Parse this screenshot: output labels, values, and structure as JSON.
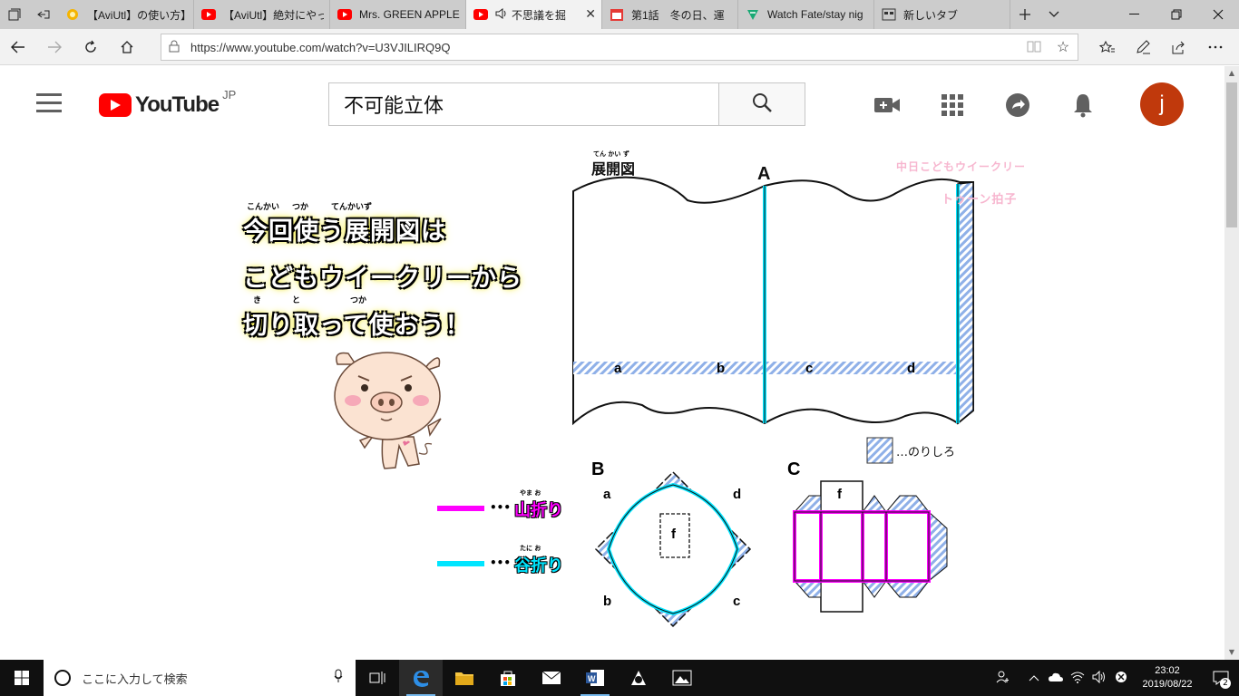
{
  "tabs": [
    {
      "title": "【AviUtl】の使い方】導",
      "icon": "sun-favicon-icon",
      "active": false
    },
    {
      "title": "【AviUtl】絶対にやって",
      "icon": "youtube-favicon-icon",
      "active": false
    },
    {
      "title": "Mrs. GREEN APPLE",
      "icon": "youtube-favicon-icon",
      "active": false
    },
    {
      "title": "不思議を掘",
      "icon": "youtube-favicon-icon",
      "active": true
    },
    {
      "title": "第1話　冬の日、運",
      "icon": "calendar-favicon-icon",
      "active": false
    },
    {
      "title": "Watch Fate/stay nig",
      "icon": "tv-favicon-icon",
      "active": false
    },
    {
      "title": "新しいタブ",
      "icon": "newtab-favicon-icon",
      "active": false
    }
  ],
  "address": {
    "url": "https://www.youtube.com/watch?v=U3VJILIRQ9Q"
  },
  "youtube": {
    "logo_text": "YouTube",
    "country": "JP",
    "search_query": "不可能立体",
    "avatar_letter": "j"
  },
  "video": {
    "caption_lines": [
      "今回使う展開図は",
      "こどもウイークリーから",
      "切り取って使おう！"
    ],
    "ruby": [
      "こんかい",
      "つか",
      "てんかいず",
      "き",
      "と",
      "つか"
    ],
    "diagram_title": "展開図",
    "diagram_title_ruby": "てん かい ず",
    "label_A": "A",
    "label_B": "B",
    "label_C": "C",
    "strip_labels": [
      "a",
      "b",
      "c",
      "d"
    ],
    "b_corner_labels": [
      "a",
      "d",
      "b",
      "c"
    ],
    "f_label": "f",
    "glue_legend": "…のりしろ",
    "mountain_fold": "山折り",
    "valley_fold": "谷折り",
    "fold_ruby": "やま お",
    "valley_ruby": "たに お",
    "dots": "•••",
    "watermark_top": "中日こどもウイークリー",
    "watermark_bottom": "トゥーン拍子",
    "colors": {
      "mountain": "#ff00ff",
      "valley": "#00e5ff",
      "glue": "#8fb0e8",
      "caption_glow": "#f0e600"
    }
  },
  "taskbar": {
    "search_placeholder": "ここに入力して検索",
    "time": "23:02",
    "date": "2019/08/22",
    "notification_count": "2"
  }
}
